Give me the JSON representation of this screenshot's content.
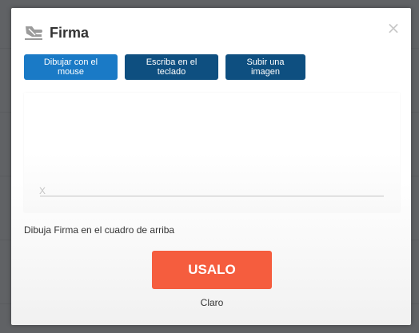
{
  "dialog": {
    "title": "Firma",
    "title_icon": "signature-hand-icon",
    "close_icon": "close-icon",
    "close_symbol": "×"
  },
  "modes": [
    {
      "label": "Dibujar con el mouse",
      "active": true
    },
    {
      "label": "Escriba en el teclado",
      "active": false
    },
    {
      "label": "Subir una imagen",
      "active": false
    }
  ],
  "canvas": {
    "sign_mark": "X"
  },
  "instructions": "Dibuja Firma en el cuadro de arriba",
  "use_button_label": "USALO",
  "clear_label": "Claro",
  "colors": {
    "active_tab": "#1a7ac6",
    "tab": "#0e4f80",
    "use_button": "#f55d3e"
  }
}
